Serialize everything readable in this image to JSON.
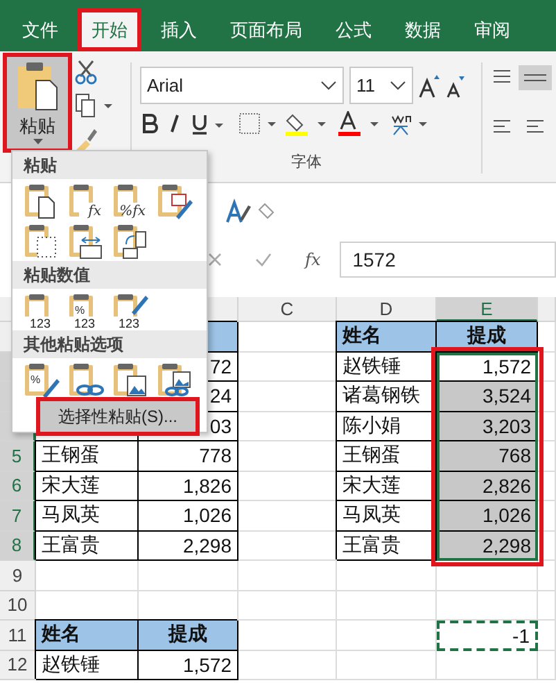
{
  "tabs": [
    {
      "label": "文件",
      "selected": false,
      "annotated": false
    },
    {
      "label": "开始",
      "selected": true,
      "annotated": true
    },
    {
      "label": "插入",
      "selected": false,
      "annotated": false
    },
    {
      "label": "页面布局",
      "selected": false,
      "annotated": false
    },
    {
      "label": "公式",
      "selected": false,
      "annotated": false
    },
    {
      "label": "数据",
      "selected": false,
      "annotated": false
    },
    {
      "label": "审阅",
      "selected": false,
      "annotated": false
    }
  ],
  "ribbon": {
    "paste_button": {
      "label": "粘贴",
      "annotated": true
    },
    "font_name": "Arial",
    "font_size": "11",
    "group_label": "字体"
  },
  "formula_bar": {
    "fx_label": "fx",
    "value": "1572"
  },
  "columns": [
    {},
    {
      "selected": false
    },
    {
      "label": "C",
      "selected": false
    },
    {
      "label": "D",
      "selected": false
    },
    {
      "label": "E",
      "selected": true
    }
  ],
  "rows": [
    {
      "selected": false,
      "cells": [
        {
          "kind": "empty"
        },
        {
          "kind": "head"
        },
        {
          "kind": "empty"
        },
        {
          "kind": "head",
          "text": "姓名"
        },
        {
          "kind": "headc",
          "text": "提成"
        }
      ]
    },
    {
      "selected": true,
      "cells": [
        {
          "kind": "empty"
        },
        {
          "kind": "num",
          "text": "72"
        },
        {
          "kind": "empty"
        },
        {
          "kind": "name",
          "text": "赵铁锤"
        },
        {
          "kind": "active",
          "text": "1,572"
        }
      ]
    },
    {
      "selected": true,
      "cells": [
        {
          "kind": "empty"
        },
        {
          "kind": "num",
          "text": "24"
        },
        {
          "kind": "empty"
        },
        {
          "kind": "name",
          "text": "诸葛钢铁"
        },
        {
          "kind": "sel",
          "text": "3,524"
        }
      ]
    },
    {
      "selected": true,
      "cells": [
        {
          "kind": "empty"
        },
        {
          "kind": "num",
          "text": "03"
        },
        {
          "kind": "empty"
        },
        {
          "kind": "name",
          "text": "陈小娟"
        },
        {
          "kind": "sel",
          "text": "3,203"
        }
      ]
    },
    {
      "num": "5",
      "selected": true,
      "cells": [
        {
          "kind": "name",
          "text": "王钢蛋"
        },
        {
          "kind": "num",
          "text": "778"
        },
        {
          "kind": "empty"
        },
        {
          "kind": "name",
          "text": "王钢蛋"
        },
        {
          "kind": "sel",
          "text": "768"
        }
      ]
    },
    {
      "num": "6",
      "selected": true,
      "cells": [
        {
          "kind": "name",
          "text": "宋大莲"
        },
        {
          "kind": "num",
          "text": "1,826"
        },
        {
          "kind": "empty"
        },
        {
          "kind": "name",
          "text": "宋大莲"
        },
        {
          "kind": "sel",
          "text": "2,826"
        }
      ]
    },
    {
      "num": "7",
      "selected": true,
      "cells": [
        {
          "kind": "name",
          "text": "马凤英"
        },
        {
          "kind": "num",
          "text": "1,026"
        },
        {
          "kind": "empty"
        },
        {
          "kind": "name",
          "text": "马凤英"
        },
        {
          "kind": "sel",
          "text": "1,026"
        }
      ]
    },
    {
      "num": "8",
      "selected": true,
      "cells": [
        {
          "kind": "name",
          "text": "王富贵"
        },
        {
          "kind": "num",
          "text": "2,298"
        },
        {
          "kind": "empty"
        },
        {
          "kind": "name",
          "text": "王富贵"
        },
        {
          "kind": "sel",
          "text": "2,298"
        }
      ]
    },
    {
      "num": "9",
      "selected": false,
      "cells": [
        {
          "kind": "empty"
        },
        {
          "kind": "empty"
        },
        {
          "kind": "empty"
        },
        {
          "kind": "empty"
        },
        {
          "kind": "empty"
        }
      ]
    },
    {
      "num": "10",
      "selected": false,
      "cells": [
        {
          "kind": "empty"
        },
        {
          "kind": "empty"
        },
        {
          "kind": "empty"
        },
        {
          "kind": "empty"
        },
        {
          "kind": "empty"
        }
      ]
    },
    {
      "num": "11",
      "selected": false,
      "cells": [
        {
          "kind": "head",
          "text": "姓名"
        },
        {
          "kind": "headc",
          "text": "提成"
        },
        {
          "kind": "empty"
        },
        {
          "kind": "empty"
        },
        {
          "kind": "copied",
          "text": "-1"
        }
      ]
    },
    {
      "num": "12",
      "selected": false,
      "cells": [
        {
          "kind": "name",
          "text": "赵铁锤"
        },
        {
          "kind": "num",
          "text": "1,572"
        },
        {
          "kind": "empty"
        },
        {
          "kind": "empty"
        },
        {
          "kind": "empty"
        }
      ]
    }
  ],
  "selection": {
    "annotated": true
  },
  "paste_menu": {
    "sections": [
      {
        "title": "粘贴",
        "icons": [
          {
            "kind": "page"
          },
          {
            "kind": "formula",
            "label": "fx"
          },
          {
            "kind": "formula",
            "label": "%fx"
          },
          {
            "kind": "brush"
          },
          {
            "kind": "noborder"
          },
          {
            "kind": "widths"
          },
          {
            "kind": "transpose"
          }
        ]
      },
      {
        "title": "粘贴数值",
        "icons": [
          {
            "kind": "values",
            "label": "123"
          },
          {
            "kind": "pctvalues",
            "badge": "%",
            "label": "123"
          },
          {
            "kind": "brushvalues",
            "label": "123"
          }
        ]
      },
      {
        "title": "其他粘贴选项",
        "icons": [
          {
            "kind": "format",
            "badge": "%"
          },
          {
            "kind": "link"
          },
          {
            "kind": "picture"
          },
          {
            "kind": "picturelink"
          }
        ]
      }
    ],
    "special": {
      "label": "选择性粘贴(S)...",
      "annotated": true
    }
  }
}
